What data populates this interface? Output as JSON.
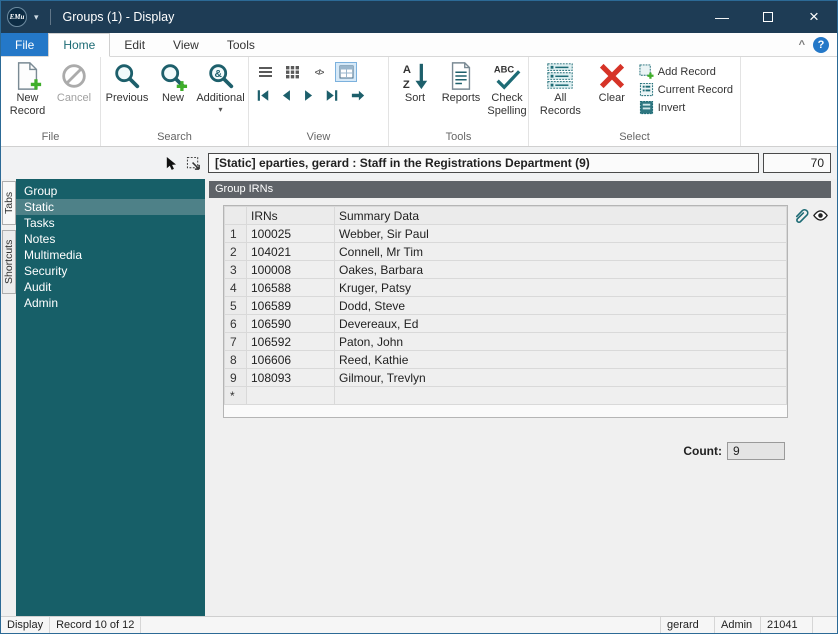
{
  "titlebar": {
    "logo": "EMu",
    "title": "Groups (1) - Display"
  },
  "icons": {
    "dropdown": "▾",
    "minimize": "—",
    "close": "×",
    "collapse": "^",
    "help": "?",
    "code_view": "</>"
  },
  "tabs": {
    "file": "File",
    "home": "Home",
    "edit": "Edit",
    "view": "View",
    "tools": "Tools"
  },
  "ribbon": {
    "file_group": {
      "label": "File",
      "new_record": "New Record",
      "cancel": "Cancel"
    },
    "search_group": {
      "label": "Search",
      "previous": "Previous",
      "new": "New",
      "additional": "Additional"
    },
    "view_group": {
      "label": "View"
    },
    "tools_group": {
      "label": "Tools",
      "sort": "Sort",
      "reports": "Reports",
      "check_spelling": "Check Spelling",
      "abc": "ABC",
      "sort_a": "A",
      "sort_z": "Z"
    },
    "select_group": {
      "label": "Select",
      "all_records": "All Records",
      "clear": "Clear",
      "add_record": "Add Record",
      "current_record": "Current Record",
      "invert": "Invert"
    }
  },
  "summary_bar": {
    "text": "[Static] eparties, gerard : Staff in the Registrations Department (9)",
    "value": "70"
  },
  "side_tabs": {
    "tabs": "Tabs",
    "shortcuts": "Shortcuts"
  },
  "sidebar": {
    "items": [
      {
        "label": "Group"
      },
      {
        "label": "Static",
        "selected": true
      },
      {
        "label": "Tasks"
      },
      {
        "label": "Notes"
      },
      {
        "label": "Multimedia"
      },
      {
        "label": "Security"
      },
      {
        "label": "Audit"
      },
      {
        "label": "Admin"
      }
    ]
  },
  "main": {
    "panel_title": "Group IRNs",
    "table": {
      "col_irns": "IRNs",
      "col_summary": "Summary Data",
      "rows": [
        {
          "num": "1",
          "irn": "100025",
          "summary": "Webber, Sir Paul"
        },
        {
          "num": "2",
          "irn": "104021",
          "summary": "Connell, Mr Tim"
        },
        {
          "num": "3",
          "irn": "100008",
          "summary": "Oakes, Barbara"
        },
        {
          "num": "4",
          "irn": "106588",
          "summary": "Kruger, Patsy"
        },
        {
          "num": "5",
          "irn": "106589",
          "summary": "Dodd, Steve"
        },
        {
          "num": "6",
          "irn": "106590",
          "summary": "Devereaux, Ed"
        },
        {
          "num": "7",
          "irn": "106592",
          "summary": "Paton, John"
        },
        {
          "num": "8",
          "irn": "106606",
          "summary": "Reed, Kathie"
        },
        {
          "num": "9",
          "irn": "108093",
          "summary": "Gilmour, Trevlyn"
        },
        {
          "num": "*",
          "irn": "",
          "summary": ""
        }
      ]
    },
    "count_label": "Count:",
    "count_value": "9"
  },
  "statusbar": {
    "mode": "Display",
    "record": "Record 10 of 12",
    "user": "gerard",
    "role": "Admin",
    "id": "21041"
  },
  "colors": {
    "accent_teal": "#1d6b75",
    "titlebar": "#1e3c55",
    "file_tab_blue": "#2478c8",
    "sidebar_teal": "#175f68",
    "clear_red": "#d63327",
    "add_green": "#3fae2a"
  }
}
